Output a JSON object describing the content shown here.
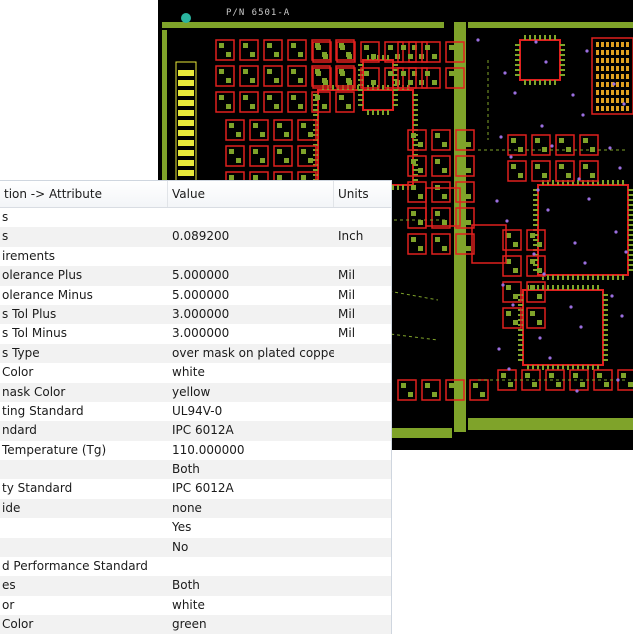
{
  "pcb": {
    "label": "P/N 6501-A"
  },
  "table": {
    "headers": {
      "attribute": "tion -> Attribute",
      "value": "Value",
      "units": "Units"
    },
    "rows": [
      {
        "attr": "s",
        "value": "",
        "units": ""
      },
      {
        "attr": "s",
        "value": "0.089200",
        "units": "Inch"
      },
      {
        "attr": "irements",
        "value": "",
        "units": ""
      },
      {
        "attr": "olerance Plus",
        "value": "5.000000",
        "units": "Mil"
      },
      {
        "attr": "olerance Minus",
        "value": "5.000000",
        "units": "Mil"
      },
      {
        "attr": "s Tol Plus",
        "value": "3.000000",
        "units": "Mil"
      },
      {
        "attr": "s Tol Minus",
        "value": "3.000000",
        "units": "Mil"
      },
      {
        "attr": "s Type",
        "value": "over mask on plated copper",
        "units": ""
      },
      {
        "attr": "Color",
        "value": "white",
        "units": ""
      },
      {
        "attr": "nask Color",
        "value": "yellow",
        "units": ""
      },
      {
        "attr": "ting Standard",
        "value": "UL94V-0",
        "units": ""
      },
      {
        "attr": "ndard",
        "value": "IPC 6012A",
        "units": ""
      },
      {
        "attr": "Temperature (Tg)",
        "value": "110.000000",
        "units": ""
      },
      {
        "attr": "",
        "value": "Both",
        "units": ""
      },
      {
        "attr": "ty Standard",
        "value": "IPC 6012A",
        "units": ""
      },
      {
        "attr": "ide",
        "value": "none",
        "units": ""
      },
      {
        "attr": "",
        "value": "Yes",
        "units": ""
      },
      {
        "attr": "",
        "value": "No",
        "units": ""
      },
      {
        "attr": "d Performance Standard",
        "value": "",
        "units": ""
      },
      {
        "attr": "es",
        "value": "Both",
        "units": ""
      },
      {
        "attr": "or",
        "value": "white",
        "units": ""
      },
      {
        "attr": "Color",
        "value": "green",
        "units": ""
      }
    ]
  },
  "colors": {
    "copper": "#7fa32a",
    "outline": "#e0201e",
    "board": "#000000",
    "silk": "#e8e83a"
  }
}
